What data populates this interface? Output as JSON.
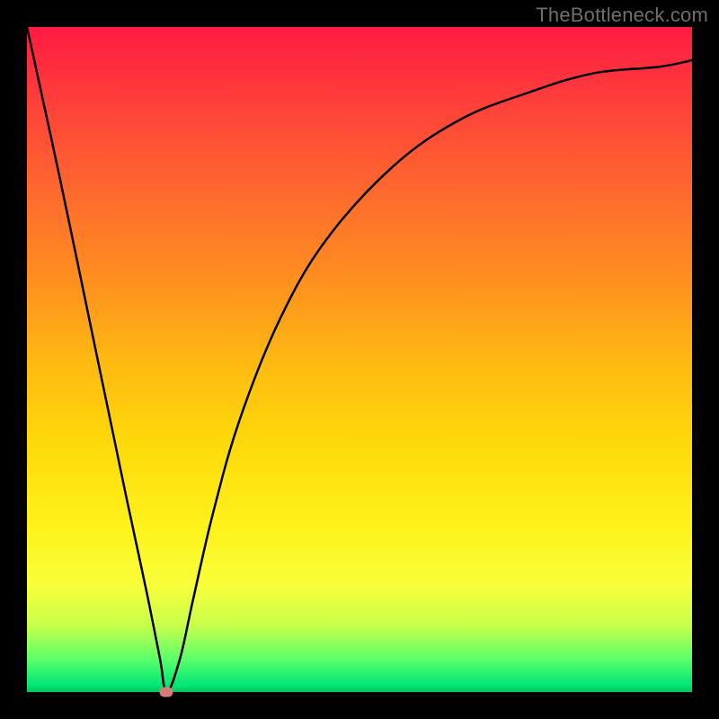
{
  "watermark": "TheBottleneck.com",
  "chart_data": {
    "type": "line",
    "title": "",
    "xlabel": "",
    "ylabel": "",
    "xlim": [
      0,
      100
    ],
    "ylim": [
      0,
      100
    ],
    "grid": false,
    "legend": false,
    "background_gradient": {
      "direction": "vertical",
      "stops": [
        {
          "pos": 0,
          "color": "#ff1a43"
        },
        {
          "pos": 0.5,
          "color": "#ffc400"
        },
        {
          "pos": 0.85,
          "color": "#ffff3a"
        },
        {
          "pos": 1.0,
          "color": "#00c853"
        }
      ]
    },
    "series": [
      {
        "name": "bottleneck-curve",
        "color": "#000000",
        "x": [
          0,
          5,
          10,
          15,
          18,
          20,
          21,
          23,
          25,
          28,
          32,
          38,
          45,
          55,
          65,
          75,
          85,
          95,
          100
        ],
        "values": [
          100,
          77,
          53,
          29,
          15,
          5,
          0,
          5,
          14,
          27,
          41,
          56,
          68,
          79,
          86,
          90,
          93,
          94,
          95
        ]
      }
    ],
    "marker": {
      "x": 21,
      "y": 0,
      "color": "#d97a7a"
    }
  }
}
